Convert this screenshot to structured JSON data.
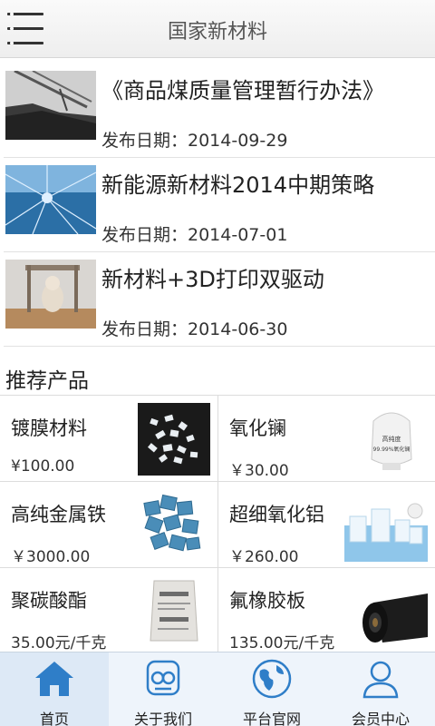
{
  "header": {
    "title": "国家新材料"
  },
  "news": [
    {
      "title": "《商品煤质量管理暂行办法》",
      "date": "发布日期：2014-09-29"
    },
    {
      "title": "新能源新材料2014中期策略",
      "date": "发布日期：2014-07-01"
    },
    {
      "title": "新材料+3D打印双驱动",
      "date": "发布日期：2014-06-30"
    }
  ],
  "products_section": {
    "title": "推荐产品",
    "items": [
      {
        "name": "镀膜材料",
        "price": "¥100.00"
      },
      {
        "name": "氧化镧",
        "price": "￥30.00"
      },
      {
        "name": "高纯金属铁",
        "price": "￥3000.00"
      },
      {
        "name": "超细氧化铝",
        "price": "￥260.00"
      },
      {
        "name": "聚碳酸酯",
        "price": "35.00元/千克"
      },
      {
        "name": "氟橡胶板",
        "price": "135.00元/千克"
      }
    ],
    "image_text": {
      "bag_label_1": "高纯度",
      "bag_label_2": "99.99%氧化镧"
    }
  },
  "bottom_nav": [
    {
      "label": "首页",
      "icon": "home-icon"
    },
    {
      "label": "关于我们",
      "icon": "about-icon"
    },
    {
      "label": "平台官网",
      "icon": "globe-icon"
    },
    {
      "label": "会员中心",
      "icon": "member-icon"
    }
  ],
  "colors": {
    "accent": "#2f7ec8",
    "nav_bg": "#eef4fb"
  }
}
